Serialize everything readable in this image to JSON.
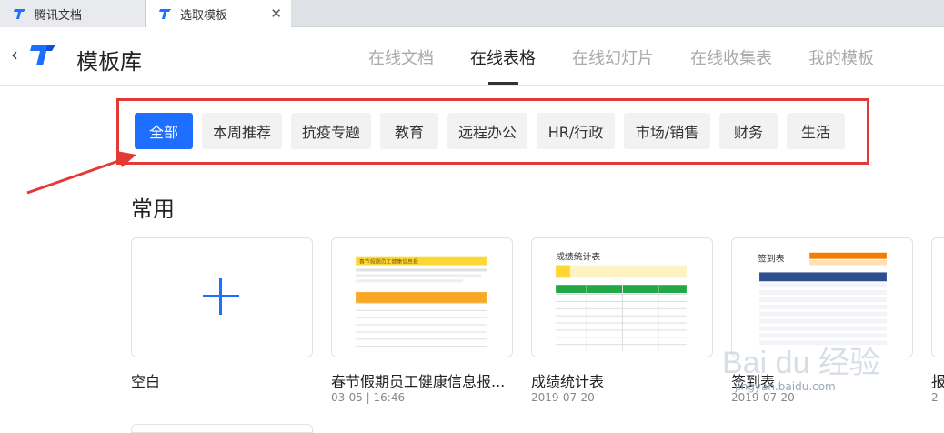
{
  "browser": {
    "tabs": [
      {
        "title": "腾讯文档"
      },
      {
        "title": "选取模板"
      }
    ],
    "close_glyph": "✕"
  },
  "header": {
    "back_glyph": "‹",
    "title": "模板库",
    "nav": [
      "在线文档",
      "在线表格",
      "在线幻灯片",
      "在线收集表",
      "我的模板"
    ],
    "active_nav": "在线表格"
  },
  "categories": [
    "全部",
    "本周推荐",
    "抗疫专题",
    "教育",
    "远程办公",
    "HR/行政",
    "市场/销售",
    "财务",
    "生活"
  ],
  "active_category": "全部",
  "section": {
    "title": "常用"
  },
  "cards": [
    {
      "name": "空白",
      "date": ""
    },
    {
      "name": "春节假期员工健康信息报...",
      "date": "03-05 | 16:46"
    },
    {
      "name": "成绩统计表",
      "date": "2019-07-20"
    },
    {
      "name": "签到表",
      "date": "2019-07-20"
    },
    {
      "name": "报",
      "date": "2"
    }
  ],
  "thumbs": {
    "t2_title": "春节假期员工健康信息报",
    "t3_title": "成绩统计表",
    "t4_title": "签到表"
  },
  "watermark": {
    "text": "jingyan.baidu.com",
    "brand": "Bai du 经验"
  },
  "colors": {
    "accent": "#1e6fff",
    "highlight": "#e53935"
  }
}
